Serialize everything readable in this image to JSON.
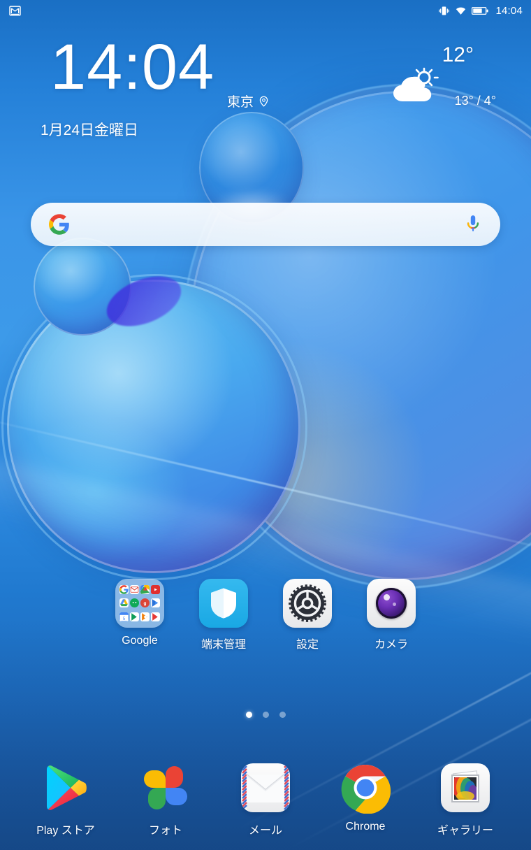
{
  "status_bar": {
    "notification_icon": "gmail-icon",
    "vibrate_icon": "vibrate-icon",
    "wifi_icon": "wifi-icon",
    "battery_icon": "battery-icon",
    "battery_level_pct": 70,
    "time": "14:04"
  },
  "clock_widget": {
    "time": "14:04",
    "city": "東京",
    "location_icon": "location-pin-icon",
    "date": "1月24日金曜日"
  },
  "weather_widget": {
    "icon": "partly-cloudy-icon",
    "current_temp": "12°",
    "range": "13° / 4°"
  },
  "search_bar": {
    "google_icon": "google-g-icon",
    "mic_icon": "microphone-icon",
    "placeholder": ""
  },
  "app_grid": [
    {
      "name": "Google",
      "icon": "folder-icon",
      "type": "folder",
      "mini_icons": [
        {
          "name": "google-icon",
          "color": "#ffffff"
        },
        {
          "name": "gmail-icon",
          "color": "#ffffff"
        },
        {
          "name": "maps-icon",
          "color": "#ffffff"
        },
        {
          "name": "youtube-icon",
          "color": "#e02f2f"
        },
        {
          "name": "drive-icon",
          "color": "#ffffff"
        },
        {
          "name": "duo-icon",
          "color": "#0fa958"
        },
        {
          "name": "google-plus-icon",
          "color": "#db4437"
        },
        {
          "name": "play-movies-icon",
          "color": "#2f6fd0"
        },
        {
          "name": "calendar-icon",
          "color": "#4286f4"
        },
        {
          "name": "play-store-icon",
          "color": "#0f9d58"
        },
        {
          "name": "podcasts-icon",
          "color": "#f2810d"
        },
        {
          "name": "play-music-icon",
          "color": "#e53935"
        }
      ]
    },
    {
      "name": "端末管理",
      "icon": "shield-icon",
      "type": "app"
    },
    {
      "name": "設定",
      "icon": "gear-icon",
      "type": "app"
    },
    {
      "name": "カメラ",
      "icon": "camera-icon",
      "type": "app"
    }
  ],
  "page_indicator": {
    "total": 3,
    "active_index": 0
  },
  "dock": [
    {
      "name": "Play ストア",
      "icon": "play-store-icon"
    },
    {
      "name": "フォト",
      "icon": "google-photos-icon"
    },
    {
      "name": "メール",
      "icon": "email-envelope-icon"
    },
    {
      "name": "Chrome",
      "icon": "chrome-icon"
    },
    {
      "name": "ギャラリー",
      "icon": "gallery-icon"
    }
  ],
  "colors": {
    "wallpaper_top": "#1a6fc4",
    "wallpaper_bottom": "#1b5697",
    "accent_cyan": "#19a8e4",
    "text_white": "#ffffff"
  }
}
